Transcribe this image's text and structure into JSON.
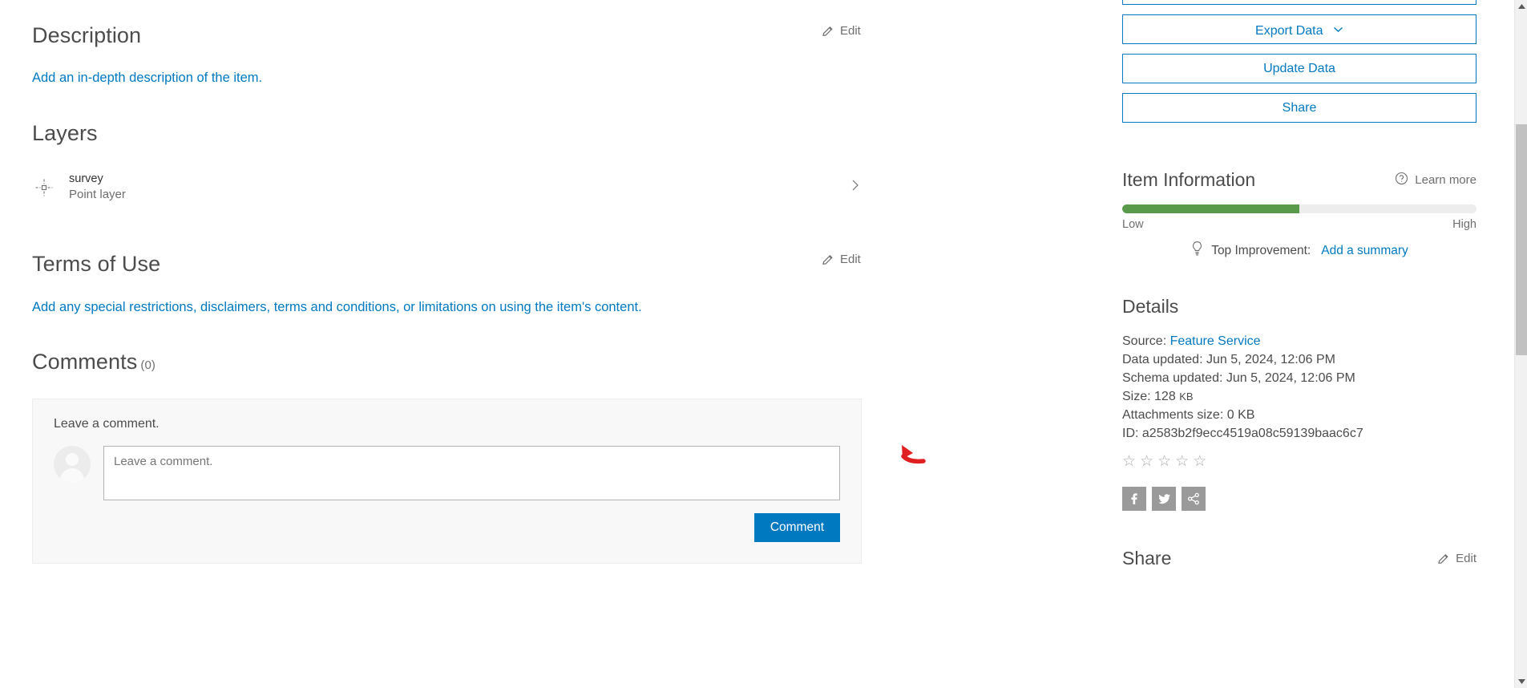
{
  "main": {
    "description": {
      "title": "Description",
      "placeholder_link": "Add an in-depth description of the item.",
      "edit_label": "Edit"
    },
    "layers": {
      "title": "Layers",
      "items": [
        {
          "name": "survey",
          "type": "Point layer"
        }
      ]
    },
    "terms": {
      "title": "Terms of Use",
      "placeholder_link": "Add any special restrictions, disclaimers, terms and conditions, or limitations on using the item's content.",
      "edit_label": "Edit"
    },
    "comments": {
      "title": "Comments",
      "count": "(0)",
      "prompt": "Leave a comment.",
      "textarea_placeholder": "Leave a comment.",
      "submit_label": "Comment"
    }
  },
  "sidebar": {
    "buttons": [
      {
        "label": "Export Data",
        "has_caret": true
      },
      {
        "label": "Update Data",
        "has_caret": false
      },
      {
        "label": "Share",
        "has_caret": false
      }
    ],
    "item_information": {
      "title": "Item Information",
      "learn_more": "Learn more",
      "meter_percent": 50,
      "meter_low_label": "Low",
      "meter_high_label": "High",
      "top_improvement_label": "Top Improvement:",
      "top_improvement_link": "Add a summary"
    },
    "details": {
      "title": "Details",
      "source_label": "Source:",
      "source_value": "Feature Service",
      "data_updated_label": "Data updated:",
      "data_updated_value": "Jun 5, 2024, 12:06 PM",
      "schema_updated_label": "Schema updated:",
      "schema_updated_value": "Jun 5, 2024, 12:06 PM",
      "size_label": "Size:",
      "size_value": "128",
      "size_unit": "KB",
      "attachments_label": "Attachments size:",
      "attachments_value": "0 KB",
      "id_label": "ID:",
      "id_value": "a2583b2f9ecc4519a08c59139baac6c7",
      "rating": 0,
      "rating_max": 5
    },
    "share_section": {
      "title": "Share",
      "edit_label": "Edit"
    }
  },
  "colors": {
    "accent_blue": "#0079c1",
    "meter_green": "#589a4a",
    "annotation_red": "#e02020",
    "text_dark": "#4c4c4c",
    "text_muted": "#6e6e6e"
  }
}
